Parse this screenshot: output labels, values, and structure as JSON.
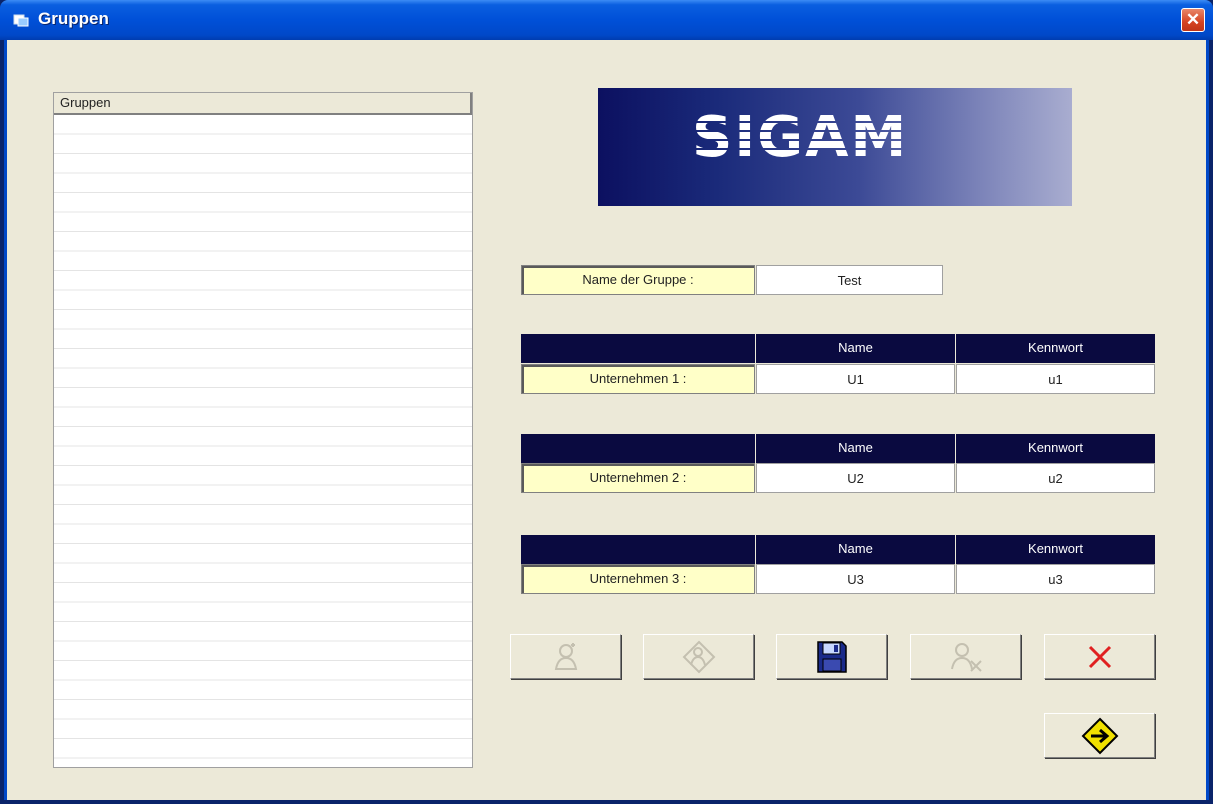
{
  "window": {
    "title": "Gruppen",
    "close_label": "✕"
  },
  "list": {
    "header": "Gruppen"
  },
  "logo": {
    "text": "SIGAM"
  },
  "group": {
    "label": "Name der Gruppe :",
    "value": "Test"
  },
  "columns": {
    "name": "Name",
    "password": "Kennwort"
  },
  "companies": [
    {
      "label": "Unternehmen 1 :",
      "name": "U1",
      "password": "u1"
    },
    {
      "label": "Unternehmen 2 :",
      "name": "U2",
      "password": "u2"
    },
    {
      "label": "Unternehmen 3 :",
      "name": "U3",
      "password": "u3"
    }
  ],
  "toolbar": {
    "icons": [
      "add-user-icon",
      "edit-user-icon",
      "floppy-disk-icon",
      "delete-user-icon",
      "close-x-icon",
      "next-arrow-icon"
    ]
  },
  "colors": {
    "title_bar": "#0050d8",
    "client_bg": "#ece9d8",
    "label_bg": "#ffffc8",
    "header_bg": "#0a0a40",
    "close_x": "#e02020",
    "arrow_sign": "#f0e000"
  }
}
